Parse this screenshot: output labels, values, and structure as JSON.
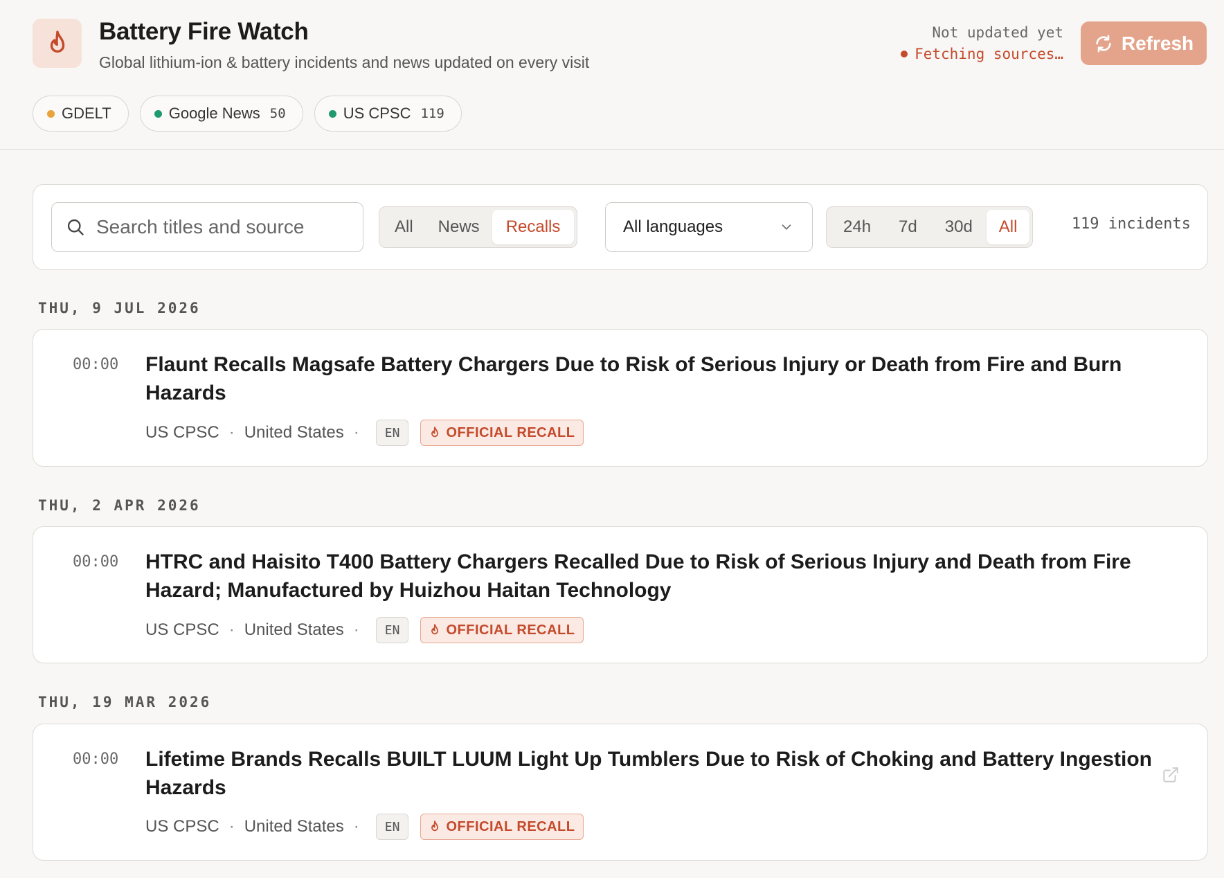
{
  "header": {
    "title": "Battery Fire Watch",
    "subtitle": "Global lithium-ion & battery incidents and news updated on every visit",
    "status_line1": "Not updated yet",
    "status_line2": "Fetching sources…",
    "refresh_label": "Refresh"
  },
  "sources": [
    {
      "name": "GDELT",
      "count": "",
      "color": "#e8a33c"
    },
    {
      "name": "Google News",
      "count": "50",
      "color": "#1f9a6d"
    },
    {
      "name": "US CPSC",
      "count": "119",
      "color": "#1f9a6d"
    }
  ],
  "filters": {
    "search_placeholder": "Search titles and source",
    "type_options": [
      "All",
      "News",
      "Recalls"
    ],
    "type_selected": "Recalls",
    "language_selected": "All languages",
    "range_options": [
      "24h",
      "7d",
      "30d",
      "All"
    ],
    "range_selected": "All",
    "incident_count": "119 incidents"
  },
  "feed": [
    {
      "date": "THU, 9 JUL 2026",
      "time": "00:00",
      "title": "Flaunt Recalls Magsafe Battery Chargers Due to Risk of Serious Injury or Death from Fire and Burn Hazards",
      "source": "US CPSC",
      "country": "United States",
      "lang": "EN",
      "badge": "OFFICIAL RECALL"
    },
    {
      "date": "THU, 2 APR 2026",
      "time": "00:00",
      "title": "HTRC and Haisito T400 Battery Chargers Recalled Due to Risk of Serious Injury and Death from Fire Hazard; Manufactured by Huizhou Haitan Technology",
      "source": "US CPSC",
      "country": "United States",
      "lang": "EN",
      "badge": "OFFICIAL RECALL"
    },
    {
      "date": "THU, 19 MAR 2026",
      "time": "00:00",
      "title": "Lifetime Brands Recalls BUILT LUUM Light Up Tumblers Due to Risk of Choking and Battery Ingestion Hazards",
      "source": "US CPSC",
      "country": "United States",
      "lang": "EN",
      "badge": "OFFICIAL RECALL"
    }
  ],
  "colors": {
    "accent": "#c44a2c",
    "refresh_bg": "#e4a48c",
    "icon_bg": "#f6e2d9"
  }
}
